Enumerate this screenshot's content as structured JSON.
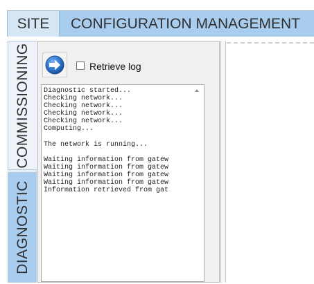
{
  "header": {
    "tabs": [
      {
        "label": "SITE"
      },
      {
        "label": "CONFIGURATION MANAGEMENT"
      }
    ]
  },
  "sidebar": {
    "tabs": [
      {
        "label": "COMMISSIONING"
      },
      {
        "label": "DIAGNOSTIC"
      }
    ]
  },
  "panel": {
    "run_icon": "arrow-right-circle-icon",
    "retrieve_log_label": "Retrieve log",
    "retrieve_log_checked": false,
    "log_lines": [
      "Diagnostic started...",
      "Checking network...",
      "Checking network...",
      "Checking network...",
      "Checking network...",
      "Computing...",
      "",
      "The network is running...",
      "",
      "Waiting information from gatew",
      "Waiting information from gatew",
      "Waiting information from gatew",
      "Waiting information from gatew",
      "Information retrieved from gat"
    ]
  },
  "colors": {
    "tab_active": "#a9cdef",
    "tab_inactive": "#d6e6f5",
    "icon_blue": "#2f78d0"
  }
}
